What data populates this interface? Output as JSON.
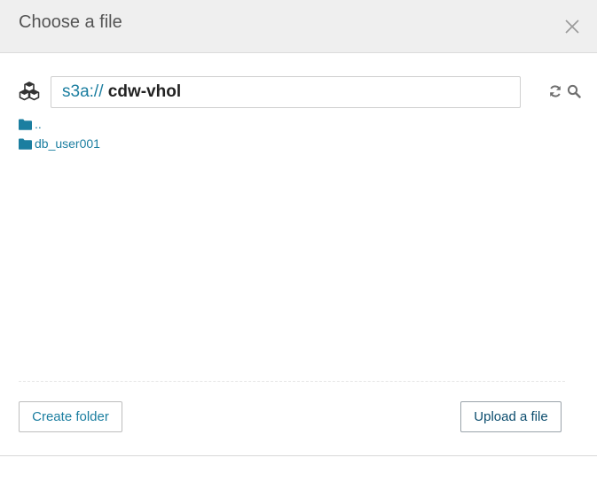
{
  "dialog": {
    "title": "Choose a file"
  },
  "path": {
    "scheme": "s3a://",
    "bucket": "cdw-vhol"
  },
  "files": [
    {
      "name": "..",
      "type": "folder"
    },
    {
      "name": "db_user001",
      "type": "folder"
    }
  ],
  "actions": {
    "create_folder": "Create folder",
    "upload_file": "Upload a file"
  },
  "icons": {
    "bucket": "cubes-icon",
    "refresh": "refresh-icon",
    "search": "search-icon",
    "close": "close-icon",
    "folder": "folder-icon"
  },
  "colors": {
    "link": "#1b7ea0",
    "header_bg": "#efefef"
  }
}
